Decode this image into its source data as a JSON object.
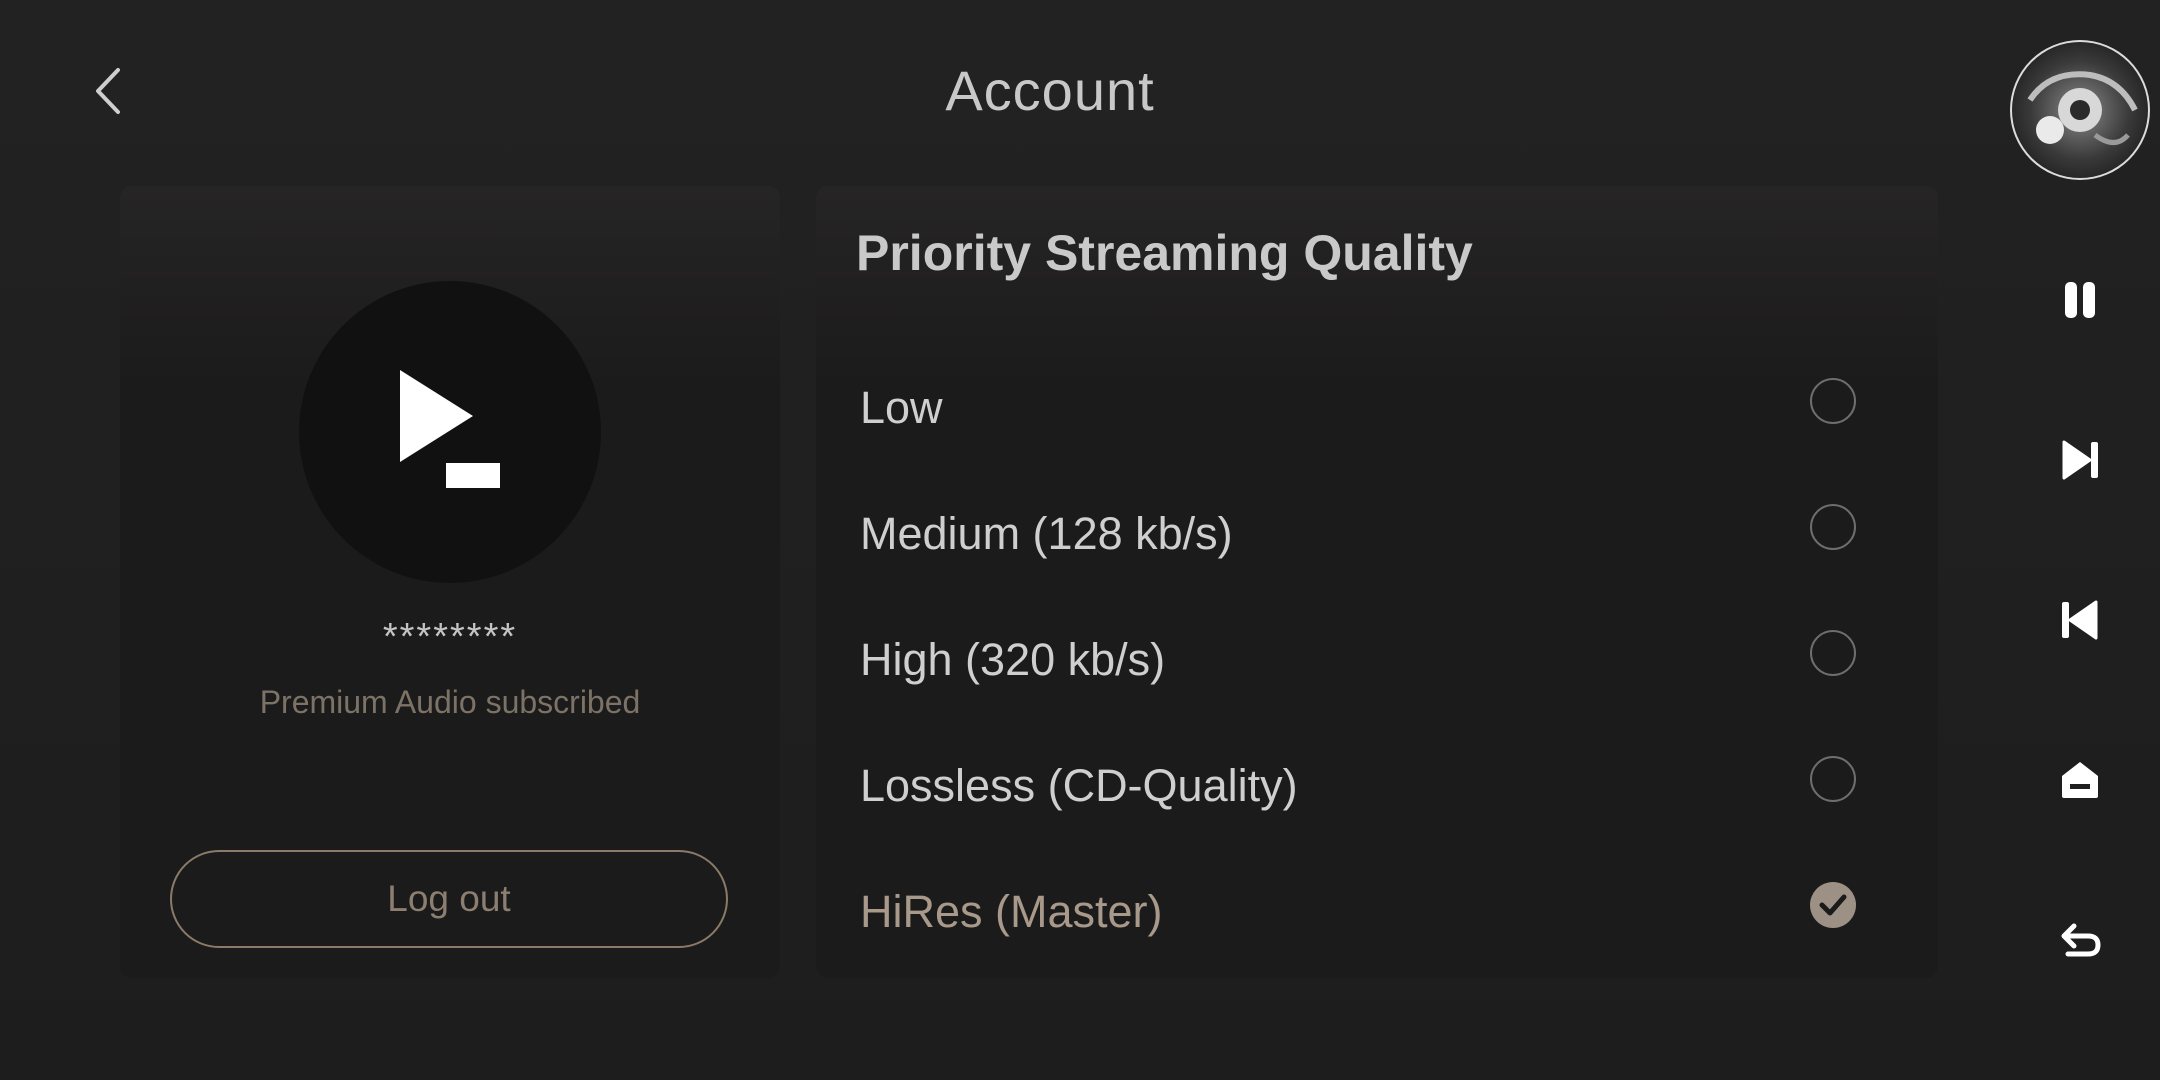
{
  "header": {
    "title": "Account",
    "back_icon": "chevron-left-icon"
  },
  "account": {
    "logo_icon": "app-logo-icon",
    "username": "********",
    "subscription": "Premium Audio subscribed",
    "logout_label": "Log out"
  },
  "streaming_quality": {
    "title": "Priority Streaming Quality",
    "options": [
      {
        "label": "Low",
        "selected": false
      },
      {
        "label": "Medium (128 kb/s)",
        "selected": false
      },
      {
        "label": "High (320 kb/s)",
        "selected": false
      },
      {
        "label": "Lossless (CD-Quality)",
        "selected": false
      },
      {
        "label": "HiRes (Master)",
        "selected": true
      }
    ]
  },
  "side_rail": {
    "items": [
      "album-art",
      "pause-icon",
      "skip-next-icon",
      "skip-previous-icon",
      "home-icon",
      "back-return-icon"
    ]
  },
  "colors": {
    "background": "#1f1f1f",
    "accent": "#9d9186",
    "text_primary": "#cfcfcf",
    "text_muted": "#7d7266"
  }
}
